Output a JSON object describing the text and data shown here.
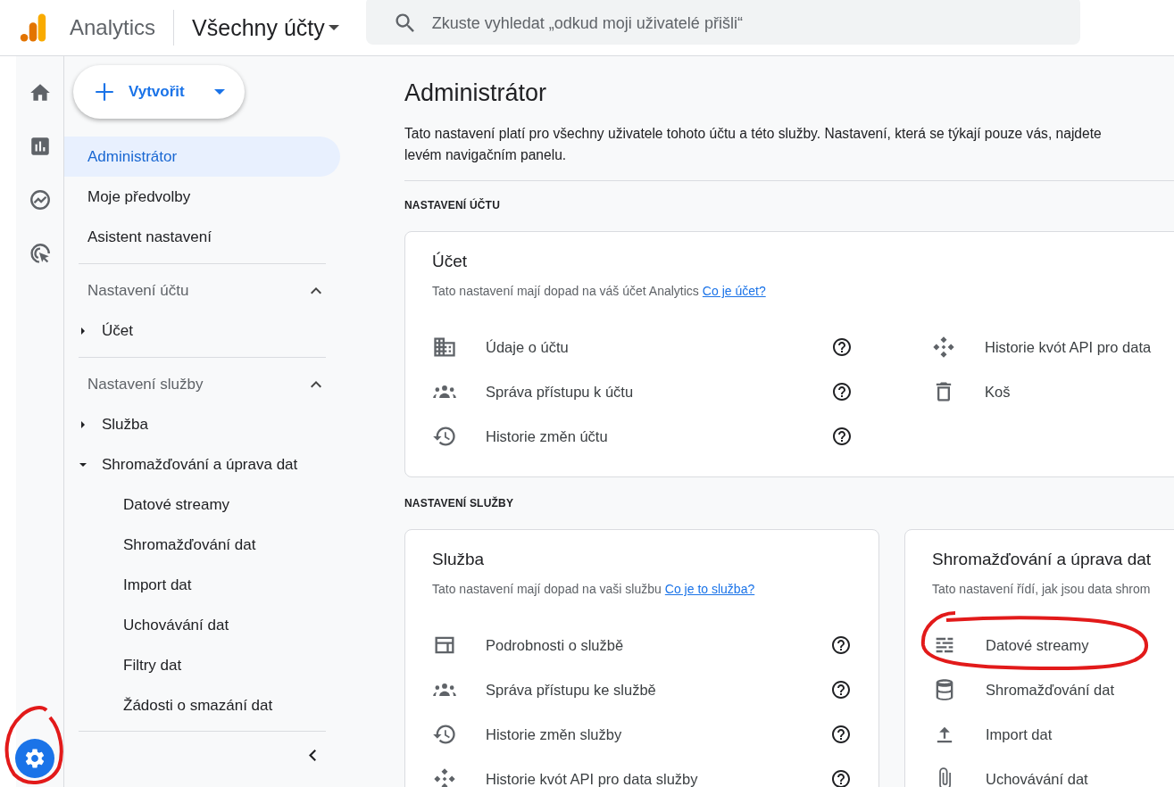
{
  "header": {
    "product": "Analytics",
    "account_picker": "Všechny účty",
    "search": {
      "placeholder": "Zkuste vyhledat „odkud moji uživatelé přišli“"
    }
  },
  "rail": [
    {
      "kind": "home",
      "selected": false
    },
    {
      "kind": "reports",
      "selected": false
    },
    {
      "kind": "explore",
      "selected": false
    },
    {
      "kind": "advertising",
      "selected": false
    },
    {
      "kind": "admin",
      "selected": true
    }
  ],
  "sidebar": {
    "create_button": "Vytvořit",
    "nav": [
      {
        "label": "Administrátor",
        "selected": true
      },
      {
        "label": "Moje předvolby",
        "selected": false
      },
      {
        "label": "Asistent nastavení",
        "selected": false
      }
    ],
    "sections": [
      {
        "title": "Nastavení účtu",
        "expanded": true,
        "items": [
          {
            "label": "Účet",
            "expanded": false
          }
        ]
      },
      {
        "title": "Nastavení služby",
        "expanded": true,
        "items": [
          {
            "label": "Služba",
            "expanded": false
          },
          {
            "label": "Shromažďování a úprava dat",
            "expanded": true,
            "children": [
              {
                "label": "Datové streamy"
              },
              {
                "label": "Shromažďování dat"
              },
              {
                "label": "Import dat"
              },
              {
                "label": "Uchovávání dat"
              },
              {
                "label": "Filtry dat"
              },
              {
                "label": "Žádosti o smazání dat"
              }
            ]
          }
        ]
      }
    ]
  },
  "main": {
    "title": "Administrátor",
    "description": [
      "Tato nastavení platí pro všechny uživatele tohoto účtu a této služby. Nastavení, která se týkají pouze vás, najdete",
      "levém navigačním panelu."
    ],
    "sections": [
      {
        "heading": "NASTAVENÍ ÚČTU",
        "cards": [
          {
            "title": "Účet",
            "intro": "Tato nastavení mají dopad na váš účet Analytics",
            "link": "Co je účet?",
            "items": [
              {
                "kind": "building",
                "label": "Údaje o účtu",
                "help": true
              },
              {
                "kind": "people",
                "label": "Správa přístupu k účtu",
                "help": true
              },
              {
                "kind": "history",
                "label": "Historie změn účtu",
                "help": true
              }
            ],
            "side_items": [
              {
                "kind": "api",
                "label": "Historie kvót API pro data"
              },
              {
                "kind": "trash",
                "label": "Koš"
              }
            ]
          }
        ]
      },
      {
        "heading": "NASTAVENÍ SLUŽBY",
        "cards": [
          {
            "title": "Služba",
            "intro": "Tato nastavení mají dopad na vaši službu",
            "link": "Co je to služba?",
            "items": [
              {
                "kind": "panel",
                "label": "Podrobnosti o službě",
                "help": true
              },
              {
                "kind": "people",
                "label": "Správa přístupu ke službě",
                "help": true
              },
              {
                "kind": "history",
                "label": "Historie změn služby",
                "help": true
              },
              {
                "kind": "api",
                "label": "Historie kvót API pro data služby",
                "help": true
              }
            ]
          },
          {
            "title": "Shromažďování a úprava dat",
            "intro": "Tato nastavení řídí, jak jsou data shrom",
            "items": [
              {
                "kind": "streams",
                "label": "Datové streamy"
              },
              {
                "kind": "database",
                "label": "Shromažďování dat"
              },
              {
                "kind": "upload",
                "label": "Import dat"
              },
              {
                "kind": "clip",
                "label": "Uchovávání dat"
              }
            ]
          }
        ]
      }
    ]
  }
}
